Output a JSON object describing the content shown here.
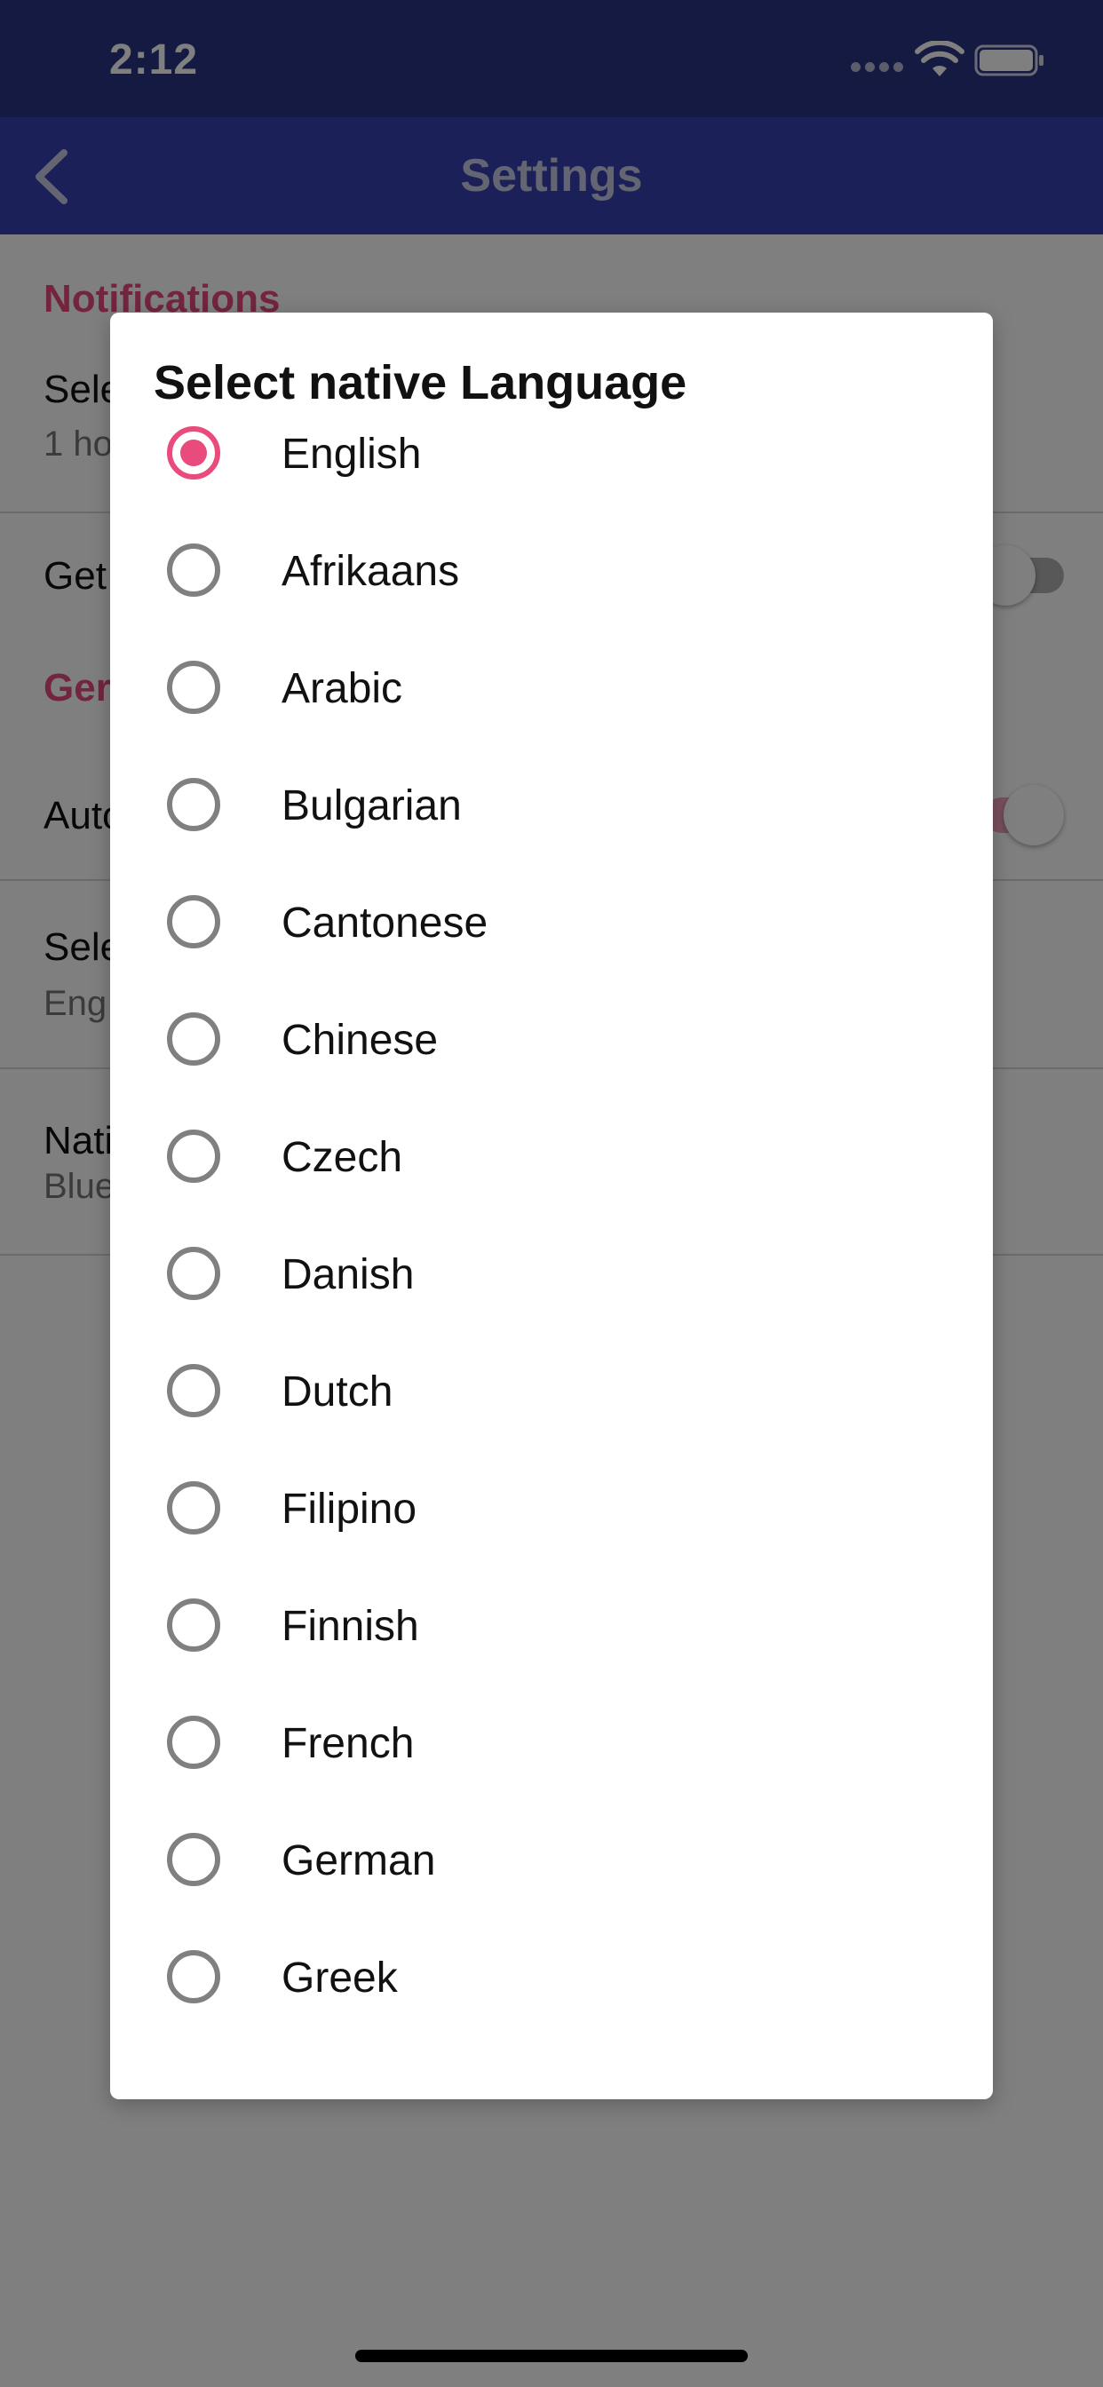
{
  "status_bar": {
    "time": "2:12"
  },
  "nav": {
    "title": "Settings"
  },
  "settings": {
    "notifications_header": "Notifications",
    "reminder_title": "Sele",
    "reminder_value": "1 ho",
    "get_notifications_title": "Get",
    "general_header": "Ger",
    "auto_title": "Auto",
    "select_language_title": "Sele",
    "select_language_value": "Eng",
    "native_title": "Nati",
    "native_value": "Blue"
  },
  "dialog": {
    "title": "Select native Language",
    "selected": "English",
    "options": [
      "English",
      "Afrikaans",
      "Arabic",
      "Bulgarian",
      "Cantonese",
      "Chinese",
      "Czech",
      "Danish",
      "Dutch",
      "Filipino",
      "Finnish",
      "French",
      "German",
      "Greek"
    ]
  },
  "colors": {
    "accent": "#e94b7d",
    "status_bar": "#2b3487",
    "nav_bar": "#3743b1",
    "radio_unselected": "#808080"
  }
}
